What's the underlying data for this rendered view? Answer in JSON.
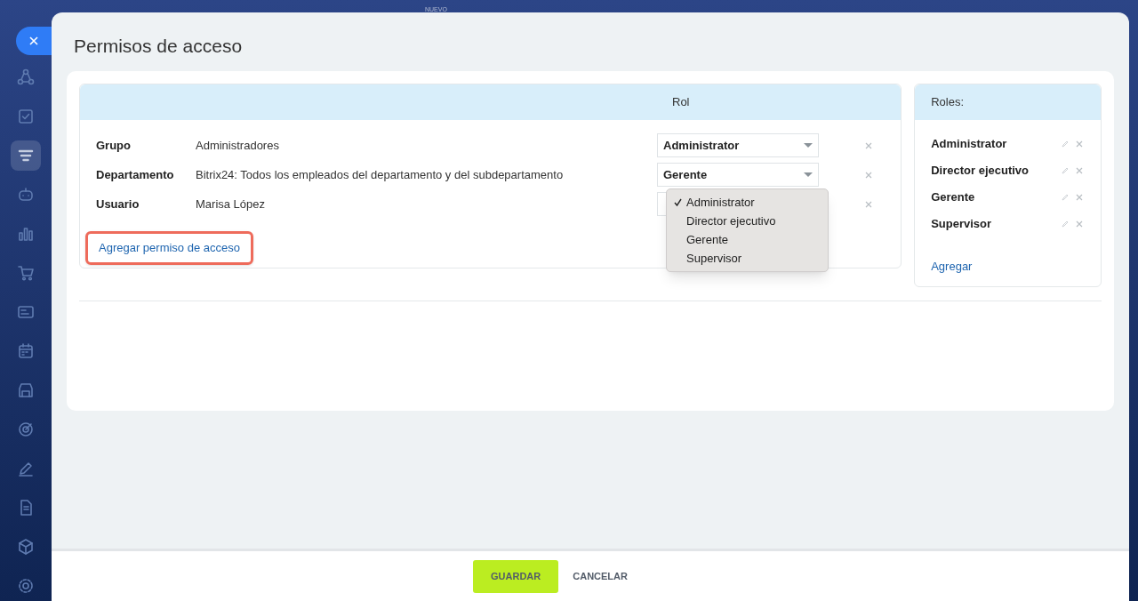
{
  "background_label": "NUEVO",
  "sidebar": {
    "items": [
      {
        "selected": false
      },
      {
        "selected": false
      },
      {
        "selected": true
      },
      {
        "selected": false
      },
      {
        "selected": false
      },
      {
        "selected": false
      },
      {
        "selected": false
      },
      {
        "selected": false
      },
      {
        "selected": false
      },
      {
        "selected": false
      },
      {
        "selected": false
      },
      {
        "selected": false
      },
      {
        "selected": false
      },
      {
        "selected": false
      }
    ]
  },
  "slider": {
    "title": "Permisos de acceso"
  },
  "permissions": {
    "columns": [
      "Rol"
    ],
    "rows": [
      {
        "type": "Grupo",
        "name": "Administradores",
        "role": "Administrator"
      },
      {
        "type": "Departamento",
        "name": "Bitrix24: Todos los empleados del departamento y del subdepartamento",
        "role": "Gerente"
      },
      {
        "type": "Usuario",
        "name": "Marisa López"
      }
    ],
    "add_link": "Agregar permiso de acceso",
    "dropdown": [
      {
        "label": "Administrator",
        "selected": true
      },
      {
        "label": "Director ejecutivo",
        "selected": false
      },
      {
        "label": "Gerente",
        "selected": false
      },
      {
        "label": "Supervisor",
        "selected": false
      }
    ]
  },
  "roles": {
    "title": "Roles:",
    "items": [
      "Administrator",
      "Director ejecutivo",
      "Gerente",
      "Supervisor"
    ],
    "add_link": "Agregar"
  },
  "footer": {
    "buttons": [
      {
        "label": "GUARDAR",
        "kind": "primary"
      },
      {
        "label": "CANCELAR",
        "kind": "link"
      }
    ]
  }
}
